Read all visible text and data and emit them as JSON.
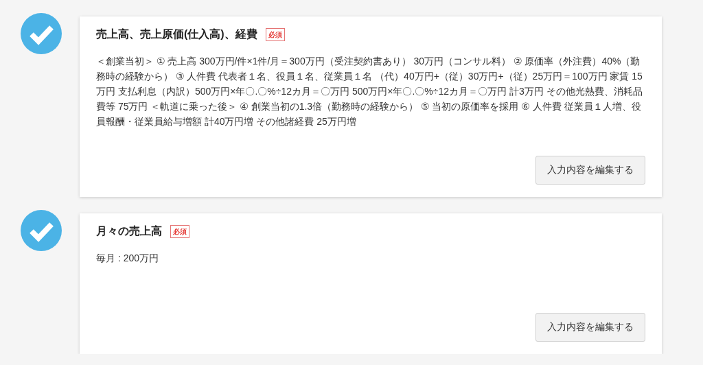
{
  "sections": [
    {
      "title": "売上高、売上原価(仕入高)、経費",
      "badge": "必須",
      "completed": true,
      "body": "＜創業当初＞ ① 売上高 300万円/件×1件/月＝300万円（受注契約書あり） 30万円（コンサル料） ② 原価率（外注費）40%（勤務時の経験から） ③ 人件費 代表者１名、役員１名、従業員１名 （代）40万円+（従）30万円+（従）25万円＝100万円 家賃 15万円 支払利息（内訳）500万円×年〇.〇%÷12カ月＝〇万円 500万円×年〇.〇%÷12カ月＝〇万円 計3万円 その他光熱費、消耗品費等 75万円 ＜軌道に乗った後＞ ④ 創業当初の1.3倍（勤務時の経験から） ⑤ 当初の原価率を採用 ⑥ 人件費 従業員１人増、役員報酬・従業員給与増額 計40万円増 その他諸経費 25万円増",
      "button": "入力内容を編集する"
    },
    {
      "title": "月々の売上高",
      "badge": "必須",
      "completed": true,
      "body": "毎月 : 200万円",
      "button": "入力内容を編集する"
    }
  ]
}
